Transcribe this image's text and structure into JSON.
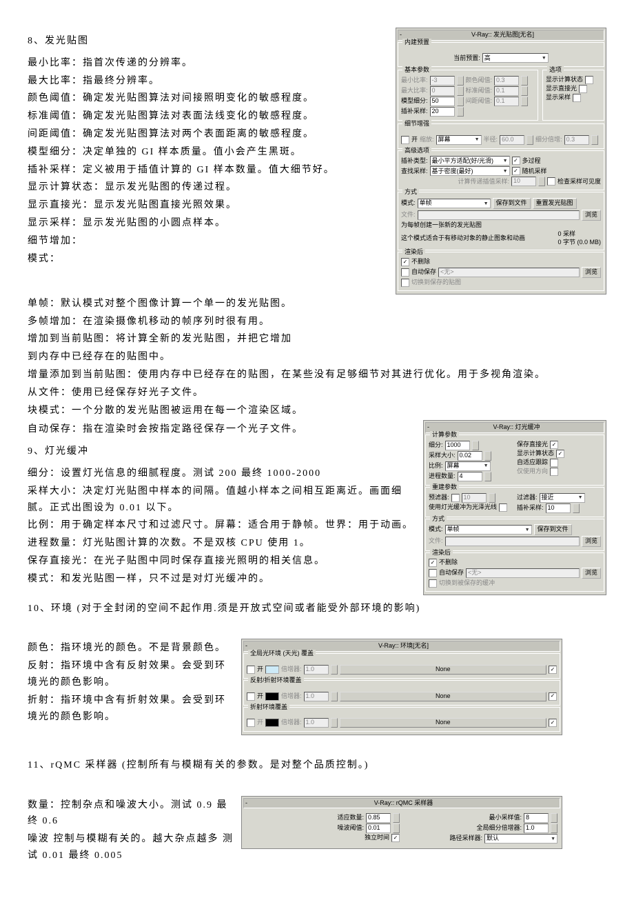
{
  "section8": {
    "title": "8、发光贴图",
    "lines": [
      "最小比率：指首次传递的分辨率。",
      "最大比率：指最终分辨率。",
      "颜色阈值：确定发光贴图算法对间接照明变化的敏感程度。",
      "标准阈值：确定发光贴图算法对表面法线变化的敏感程度。",
      "间距阈值：确定发光贴图算法对两个表面距离的敏感程度。",
      "模型细分：决定单独的 GI 样本质量。值小会产生黑斑。",
      "插补采样：定义被用于插值计算的 GI 样本数量。值大细节好。",
      "显示计算状态：显示发光贴图的传递过程。",
      "显示直接光：显示发光贴图直接光照效果。",
      "显示采样：显示发光贴图的小圆点样本。",
      "细节增加：",
      "模式："
    ],
    "modes": [
      "单帧：默认模式对整个图像计算一个单一的发光贴图。",
      "多帧增加：在渲染摄像机移动的帧序列时很有用。",
      "增加到当前贴图：将计算全新的发光贴图，并把它增加",
      "到内存中已经存在的贴图中。",
      "增量添加到当前贴图：使用内存中已经存在的贴图，在某些没有足够细节对其进行优化。用于多视角渲染。",
      "从文件：使用已经保存好光子文件。",
      "块模式：一个分散的发光贴图被运用在每一个渲染区域。",
      "自动保存：指在渲染时会按指定路径保存一个光子文件。"
    ]
  },
  "section9": {
    "title": "9、灯光缓冲",
    "lines": [
      "细分：设置灯光信息的细腻程度。测试 200  最终 1000-2000",
      "采样大小：决定灯光贴图中样本的间隔。值越小样本之间相互距离近。画面细腻。正式出图设为 0.01 以下。",
      "比例：用于确定样本尺寸和过滤尺寸。屏幕：适合用于静帧。世界：用于动画。",
      "进程数量：灯光贴图计算的次数。不是双核 CPU 使用 1。",
      "保存直接光：在光子贴图中同时保存直接光照明的相关信息。",
      "模式：和发光贴图一样，只不过是对灯光缓冲的。"
    ]
  },
  "section10": {
    "title": "10、环境    (对于全封闭的空间不起作用.须是开放式空间或者能受外部环境的影响)",
    "lines": [
      "颜色：指环境光的颜色。不是背景颜色。",
      "反射：指环境中含有反射效果。会受到环境光的颜色影响。",
      "折射：指环境中含有折射效果。会受到环境光的颜色影响。"
    ]
  },
  "section11": {
    "title": "11、rQMC 采样器    (控制所有与模糊有关的参数。是对整个品质控制。)",
    "lines": [
      "数量：控制杂点和噪波大小。测试 0.9 最终 0.6",
      "噪波  控制与模糊有关的。越大杂点越多  测试 0.01  最终 0.005"
    ]
  },
  "panel_irr": {
    "title": "V-Ray:: 发光贴图[无名]",
    "preset_group": "内建预置",
    "preset_lbl": "当前预置:",
    "preset_val": "高",
    "basic_group": "基本参数",
    "options_group": "选项",
    "min_rate_lbl": "最小比率:",
    "min_rate_val": "-3",
    "max_rate_lbl": "最大比率:",
    "max_rate_val": "0",
    "model_sub_lbl": "模型细分:",
    "model_sub_val": "50",
    "interp_lbl": "插补采样:",
    "interp_val": "20",
    "color_th_lbl": "颜色阈值:",
    "color_th_val": "0.3",
    "norm_th_lbl": "标准阈值:",
    "norm_th_val": "0.1",
    "dist_th_lbl": "间距阈值:",
    "dist_th_val": "0.1",
    "show_calc": "显示计算状态",
    "show_direct": "显示直接光",
    "show_samples": "显示采样",
    "detail_group": "细节增强",
    "detail_on": "开",
    "detail_scale_lbl": "缩放:",
    "detail_scale_val": "屏幕",
    "detail_radius_lbl": "半径:",
    "detail_radius_val": "60.0",
    "detail_mult_lbl": "细分倍增:",
    "detail_mult_val": "0.3",
    "adv_group": "高级选项",
    "interp_type_lbl": "插补类型:",
    "interp_type_val": "最小平方适配(好/光滑)",
    "lookup_lbl": "查找采样:",
    "lookup_val": "基于密度(最好)",
    "multipass": "多过程",
    "randomize": "随机采样",
    "check_vis": "检查采样可见度",
    "calc_interp_lbl": "计算传递插值采样:",
    "calc_interp_val": "10",
    "mode_group": "方式",
    "mode_lbl": "模式:",
    "mode_val": "单帧",
    "save_btn": "保存到文件",
    "reset_btn": "重置发光贴图",
    "file_lbl": "文件:",
    "browse_btn": "浏览",
    "mode_note1": "为每帧创建一张新的发光贴图",
    "mode_note2": "这个模式适合于有移动对象的静止图象和动画",
    "samples_info": "0 采样",
    "bytes_info": "0 字节 (0.0 MB)",
    "post_group": "渲染后",
    "no_delete": "不删除",
    "auto_save": "自动保存",
    "auto_save_path": "<无>",
    "browse2": "浏览",
    "switch_saved": "切换到保存的贴图"
  },
  "panel_lc": {
    "title": "V-Ray:: 灯光缓冲",
    "calc_group": "计算参数",
    "sub_lbl": "细分:",
    "sub_val": "1000",
    "size_lbl": "采样大小:",
    "size_val": "0.02",
    "scale_lbl": "比例:",
    "scale_val": "屏幕",
    "passes_lbl": "进程数量:",
    "passes_val": "4",
    "store_direct": "保存直接光",
    "show_calc": "显示计算状态",
    "adaptive": "自适应跟踪",
    "use_only": "仅使用方向",
    "recon_group": "重建参数",
    "prefilter_lbl": "预滤器:",
    "prefilter_val": "10",
    "use_lc_gloss": "使用灯光缓冲为光泽光线",
    "filter_lbl": "过滤器:",
    "filter_val": "接近",
    "interp_lbl": "插补采样:",
    "interp_val": "10",
    "mode_group": "方式",
    "mode_lbl": "模式:",
    "mode_val": "单帧",
    "save_btn": "保存到文件",
    "file_lbl": "文件:",
    "browse_btn": "浏览",
    "post_group": "渲染后",
    "no_delete": "不删除",
    "auto_save": "自动保存",
    "auto_save_path": "<无>",
    "browse2": "浏览",
    "switch_saved": "切换到被保存的缓冲"
  },
  "panel_env": {
    "title": "V-Ray:: 环境[无名]",
    "gi_group": "全局光环境 (天光) 覆盖",
    "rr_group": "反射/折射环境覆盖",
    "rf_group": "折射环境覆盖",
    "on_lbl": "开",
    "mult_lbl": "倍增器:",
    "mult_val": "1.0",
    "none_btn": "None"
  },
  "panel_rqmc": {
    "title": "V-Ray:: rQMC 采样器",
    "amount_lbl": "适应数量:",
    "amount_val": "0.85",
    "noise_lbl": "噪波阈值:",
    "noise_val": "0.01",
    "indep_lbl": "独立时间",
    "min_samp_lbl": "最小采样值:",
    "min_samp_val": "8",
    "global_mult_lbl": "全局细分倍增器:",
    "global_mult_val": "1.0",
    "path_lbl": "路径采样器:",
    "path_val": "默认"
  }
}
